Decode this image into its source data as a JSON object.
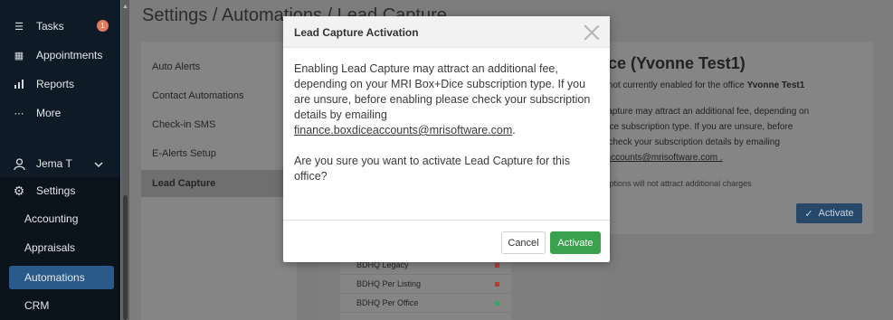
{
  "sidebar": {
    "items": [
      {
        "label": "Tasks",
        "icon": "tasks-icon",
        "badge": "1"
      },
      {
        "label": "Appointments",
        "icon": "calendar-icon"
      },
      {
        "label": "Reports",
        "icon": "bar-chart-icon"
      },
      {
        "label": "More",
        "icon": "more-icon"
      }
    ],
    "user": {
      "label": "Jema T",
      "icon": "user-icon"
    },
    "settings": {
      "label": "Settings",
      "icon": "gear-icon"
    },
    "sub_items": [
      "Accounting",
      "Appraisals",
      "Automations",
      "CRM"
    ],
    "active_sub": "Automations"
  },
  "main": {
    "breadcrumb": "Settings / Automations / Lead Capture",
    "subnav": [
      "Auto Alerts",
      "Contact Automations",
      "Check-in SMS",
      "E-Alerts Setup",
      "Lead Capture"
    ],
    "active_subnav": "Lead Capture",
    "card": {
      "heading": "ce (Yvonne Test1)",
      "line1_prefix": "s not currently enabled for the office ",
      "line1_bold": "Yvonne Test1",
      "line2": "Capture may attract an additional fee, depending on",
      "line3": "Dice subscription type. If you are unsure, before",
      "line4": "e check your subscription details by emailing",
      "line5": "eaccounts@mrisoftware.com .",
      "note": "criptions will not attract additional charges",
      "activate_label": "Activate"
    },
    "list": [
      {
        "label": "BDHQ Legacy",
        "status_color": "#c0392b"
      },
      {
        "label": "BDHQ Per Listing",
        "status_color": "#c0392b"
      },
      {
        "label": "BDHQ Per Office",
        "status_color": "#27ae60"
      }
    ]
  },
  "modal": {
    "title": "Lead Capture Activation",
    "para1": "Enabling Lead Capture may attract an additional fee, depending on your MRI Box+Dice subscription type. If you are unsure, before enabling please check your subscription details by emailing ",
    "email": "finance.boxdiceaccounts@mrisoftware.com",
    "para1_end": ".",
    "para2": "Are you sure you want to activate Lead Capture for this office?",
    "cancel_label": "Cancel",
    "activate_label": "Activate",
    "activate_color": "#3aa14e"
  }
}
